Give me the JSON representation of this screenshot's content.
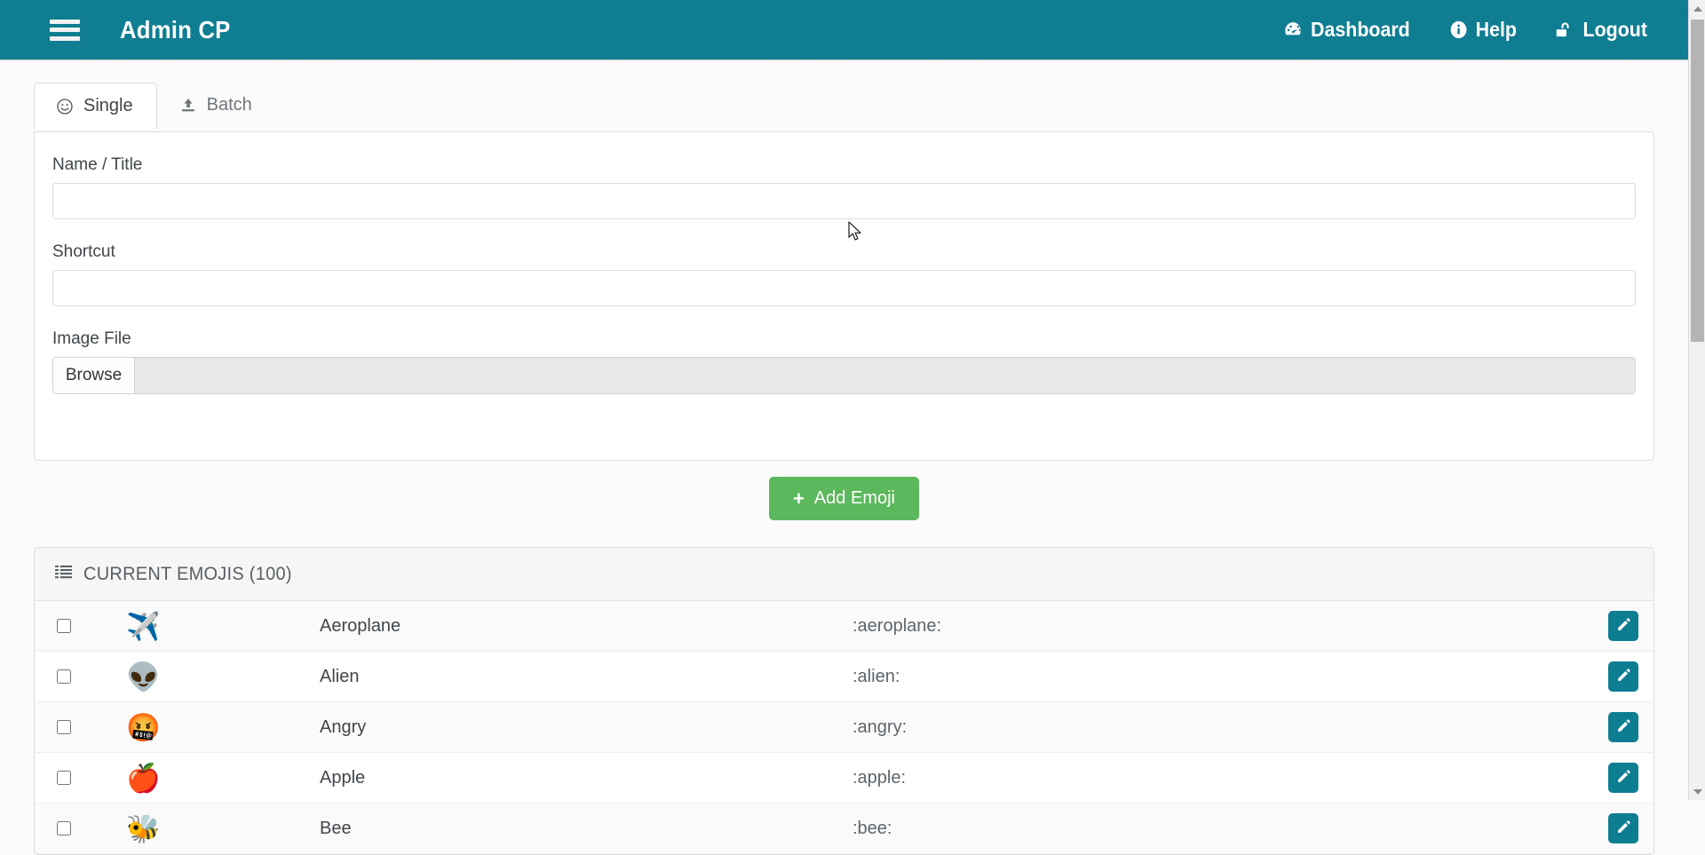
{
  "header": {
    "menu_icon": "hamburger-menu-icon",
    "title": "Admin CP",
    "nav": [
      {
        "label": "Dashboard",
        "icon": "dashboard-gauge-icon"
      },
      {
        "label": "Help",
        "icon": "info-circle-icon"
      },
      {
        "label": "Logout",
        "icon": "unlock-icon"
      }
    ]
  },
  "tabs": [
    {
      "label": "Single",
      "icon": "smiley-face-icon",
      "active": true
    },
    {
      "label": "Batch",
      "icon": "upload-icon",
      "active": false
    }
  ],
  "form": {
    "name_label": "Name / Title",
    "name_value": "",
    "name_placeholder": "",
    "shortcut_label": "Shortcut",
    "shortcut_value": "",
    "shortcut_placeholder": "",
    "image_label": "Image File",
    "browse_label": "Browse",
    "file_name": ""
  },
  "submit": {
    "label": "Add Emoji",
    "icon": "plus-icon",
    "color": "#5cb85c"
  },
  "list": {
    "title": "CURRENT EMOJIS (100)",
    "icon": "list-icon",
    "count": 100,
    "edit_icon": "pencil-icon",
    "edit_color": "#0d7d92",
    "rows": [
      {
        "name": "Aeroplane",
        "shortcut": ":aeroplane:",
        "emoji": "✈️",
        "checked": false
      },
      {
        "name": "Alien",
        "shortcut": ":alien:",
        "emoji": "👽",
        "checked": false
      },
      {
        "name": "Angry",
        "shortcut": ":angry:",
        "emoji": "🤬",
        "checked": false
      },
      {
        "name": "Apple",
        "shortcut": ":apple:",
        "emoji": "🍎",
        "checked": false
      },
      {
        "name": "Bee",
        "shortcut": ":bee:",
        "emoji": "🐝",
        "checked": false
      }
    ]
  },
  "colors": {
    "brand_teal": "#0d7d92",
    "add_green": "#5cb85c",
    "page_bg": "#fbfbfb"
  }
}
